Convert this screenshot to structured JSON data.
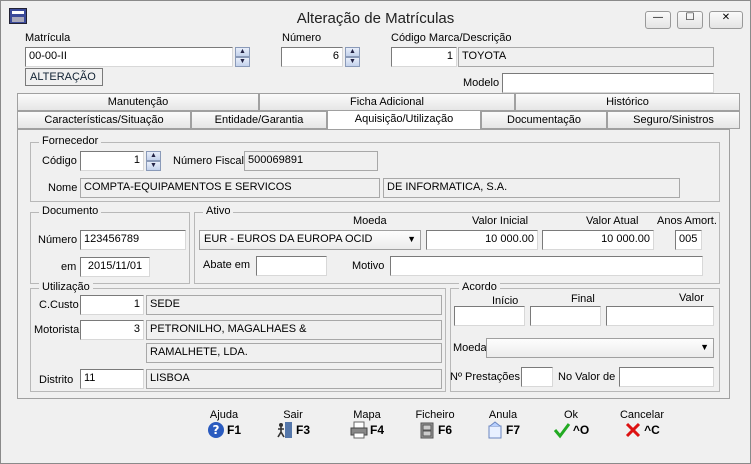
{
  "window": {
    "title": "Alteração de Matrículas",
    "minimize": "—",
    "maximize": "☐",
    "close": "✕"
  },
  "header": {
    "matricula_label": "Matrícula",
    "matricula_value": "00-00-II",
    "status": "ALTERAÇÃO",
    "numero_label": "Número",
    "numero_value": "6",
    "marca_label": "Código Marca/Descrição",
    "marca_code": "1",
    "marca_desc": "TOYOTA",
    "modelo_label": "Modelo",
    "modelo_value": ""
  },
  "tabs_row1": [
    "Manutenção",
    "Ficha Adicional",
    "Histórico"
  ],
  "tabs_row2": [
    "Características/Situação",
    "Entidade/Garantia",
    "Aquisição/Utilização",
    "Documentação",
    "Seguro/Sinistros"
  ],
  "fornecedor": {
    "title": "Fornecedor",
    "codigo_label": "Código",
    "codigo_value": "1",
    "nif_label": "Número Fiscal",
    "nif_value": "500069891",
    "nome_label": "Nome",
    "nome_value1": "COMPTA-EQUIPAMENTOS E SERVICOS",
    "nome_value2": "DE INFORMATICA, S.A."
  },
  "documento": {
    "title": "Documento",
    "numero_label": "Número",
    "numero_value": "123456789",
    "em_label": "em",
    "em_value": "2015/11/01"
  },
  "ativo": {
    "title": "Ativo",
    "moeda_label": "Moeda",
    "moeda_value": "EUR - EUROS DA EUROPA OCID",
    "valor_inicial_label": "Valor Inicial",
    "valor_inicial_value": "10 000.00",
    "valor_atual_label": "Valor Atual",
    "valor_atual_value": "10 000.00",
    "anos_label": "Anos Amort.",
    "anos_value": "005",
    "abate_label": "Abate em",
    "abate_value": "",
    "motivo_label": "Motivo",
    "motivo_value": ""
  },
  "utilizacao": {
    "title": "Utilização",
    "ccusto_label": "C.Custo",
    "ccusto_value": "1",
    "ccusto_desc": "SEDE",
    "motorista_label": "Motorista",
    "motorista_value": "3",
    "motorista_desc1": "PETRONILHO, MAGALHAES &",
    "motorista_desc2": "RAMALHETE, LDA.",
    "distrito_label": "Distrito",
    "distrito_value": "11",
    "distrito_desc": "LISBOA"
  },
  "acordo": {
    "title": "Acordo",
    "inicio_label": "Início",
    "final_label": "Final",
    "valor_label": "Valor",
    "moeda_label": "Moeda",
    "prestacoes_label": "Nº Prestações",
    "novalor_label": "No Valor de"
  },
  "fkeys": [
    {
      "label": "Ajuda",
      "key": "F1"
    },
    {
      "label": "Sair",
      "key": "F3"
    },
    {
      "label": "Mapa",
      "key": "F4"
    },
    {
      "label": "Ficheiro",
      "key": "F6"
    },
    {
      "label": "Anula",
      "key": "F7"
    },
    {
      "label": "Ok",
      "key": "^O"
    },
    {
      "label": "Cancelar",
      "key": "^C"
    }
  ]
}
